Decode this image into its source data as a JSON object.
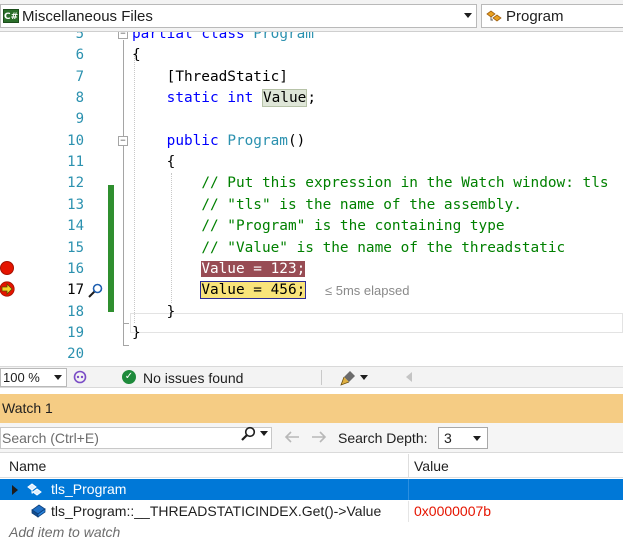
{
  "navbar": {
    "file_combo": {
      "icon": "csharp-file-icon",
      "label": "C#",
      "value": "Miscellaneous Files"
    },
    "member_combo": {
      "icon": "class-icon",
      "value": "Program"
    }
  },
  "editor": {
    "lines": [
      {
        "number": "5",
        "tokens": [
          {
            "t": "partial",
            "c": "kw"
          },
          {
            "t": " "
          },
          {
            "t": "class",
            "c": "kw"
          },
          {
            "t": " "
          },
          {
            "t": "Program",
            "c": "ty"
          }
        ]
      },
      {
        "number": "6",
        "tokens": [
          {
            "t": "{"
          }
        ]
      },
      {
        "number": "7",
        "tokens": [
          {
            "t": "    [ThreadStatic]"
          }
        ]
      },
      {
        "number": "8",
        "tokens": [
          {
            "t": "    "
          },
          {
            "t": "static",
            "c": "kw"
          },
          {
            "t": " "
          },
          {
            "t": "int",
            "c": "kw"
          },
          {
            "t": " "
          },
          {
            "t": "Value",
            "c": "hl-ref"
          },
          {
            "t": ";"
          }
        ]
      },
      {
        "number": "9",
        "tokens": []
      },
      {
        "number": "10",
        "tokens": [
          {
            "t": "    "
          },
          {
            "t": "public",
            "c": "kw"
          },
          {
            "t": " "
          },
          {
            "t": "Program",
            "c": "ty"
          },
          {
            "t": "()"
          }
        ]
      },
      {
        "number": "11",
        "tokens": [
          {
            "t": "    {"
          }
        ]
      },
      {
        "number": "12",
        "tokens": [
          {
            "t": "        "
          },
          {
            "t": "// Put this expression in the Watch window: tls",
            "c": "cm"
          }
        ]
      },
      {
        "number": "13",
        "tokens": [
          {
            "t": "        "
          },
          {
            "t": "// \"tls\" is the name of the assembly.",
            "c": "cm"
          }
        ]
      },
      {
        "number": "14",
        "tokens": [
          {
            "t": "        "
          },
          {
            "t": "// \"Program\" is the containing type",
            "c": "cm"
          }
        ]
      },
      {
        "number": "15",
        "tokens": [
          {
            "t": "        "
          },
          {
            "t": "// \"Value\" is the name of the threadstatic",
            "c": "cm"
          }
        ]
      },
      {
        "number": "16",
        "breakpoint": true,
        "tokens": [
          {
            "t": "        "
          },
          {
            "t": "Value = 123;",
            "c": "bp-line"
          }
        ]
      },
      {
        "number": "17",
        "current": true,
        "tokens": [
          {
            "t": "        "
          },
          {
            "t": "Value = 456;",
            "c": "cur-line"
          }
        ],
        "elapsed": "≤ 5ms elapsed"
      },
      {
        "number": "18",
        "tokens": [
          {
            "t": "    }"
          }
        ]
      },
      {
        "number": "19",
        "tokens": [
          {
            "t": "}"
          }
        ]
      },
      {
        "number": "20",
        "tokens": []
      }
    ],
    "colors": {
      "keyword": "#0000ff",
      "type": "#2b91af",
      "comment": "#008000",
      "breakpoint": "#e51400",
      "current_statement": "#f9e47a"
    }
  },
  "edstatus": {
    "zoom": "100 %",
    "issues_icon": "check-circle-icon",
    "issues_text": "No issues found"
  },
  "watch": {
    "title": "Watch 1",
    "search_placeholder": "Search (Ctrl+E)",
    "search_depth_label": "Search Depth:",
    "search_depth_value": "3",
    "columns": {
      "name": "Name",
      "value": "Value"
    },
    "rows": [
      {
        "name": "tls_Program",
        "value": "",
        "selected": true,
        "expandable": true,
        "icon": "class-member-icon"
      },
      {
        "name": "tls_Program::__THREADSTATICINDEX.Get()->Value",
        "value": "0x0000007b",
        "changed": true,
        "icon": "field-icon"
      }
    ],
    "add_item_placeholder": "Add item to watch"
  }
}
